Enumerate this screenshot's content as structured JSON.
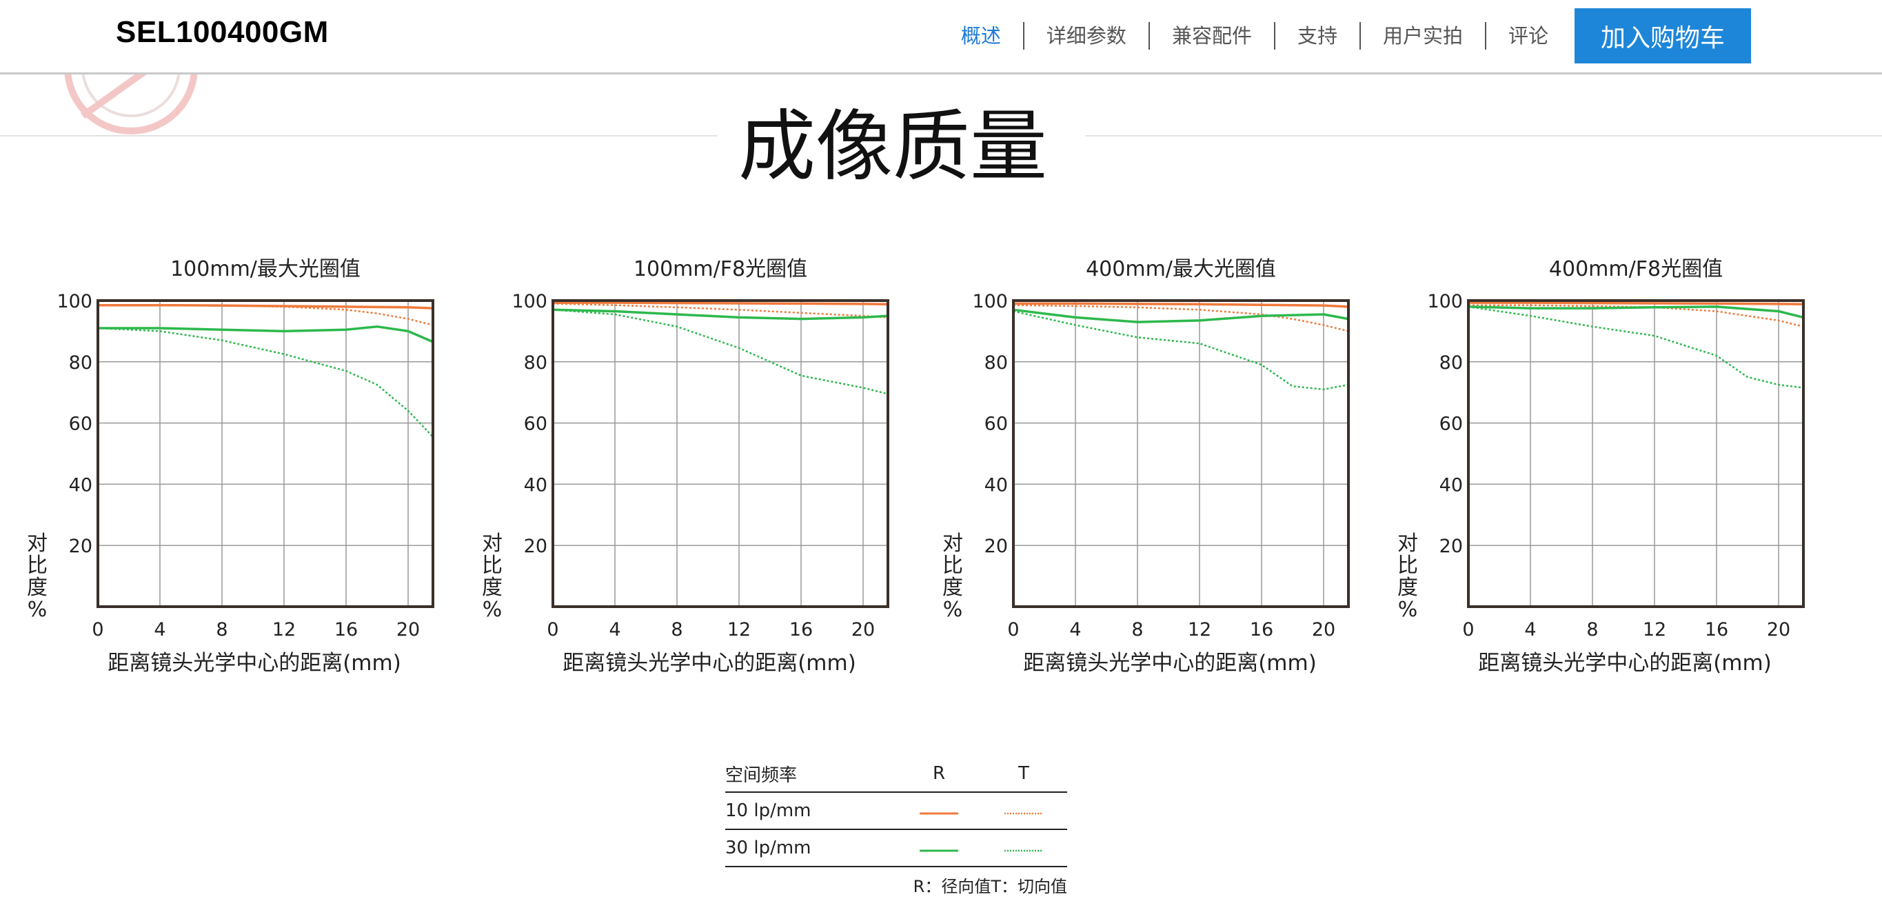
{
  "header": {
    "product_name": "SEL100400GM",
    "nav": [
      "概述",
      "详细参数",
      "兼容配件",
      "支持",
      "用户实拍",
      "评论"
    ],
    "active_nav": "概述",
    "cart_button": "加入购物车",
    "accent_color": "#1d86d9"
  },
  "section": {
    "title": "成像质量"
  },
  "colors": {
    "r10": "#f07a3c",
    "t10": "#f07a3c",
    "r30": "#2db84d",
    "t30": "#2db84d",
    "grid": "#999999",
    "frame": "#3a2f2a"
  },
  "chart_data": [
    {
      "type": "line",
      "title": "100mm/最大光圈值",
      "xlabel": "距离镜头光学中心的距离(mm)",
      "ylabel": "对比度%",
      "xlim": [
        0,
        21.6
      ],
      "ylim": [
        0,
        100
      ],
      "xticks": [
        0,
        4,
        8,
        12,
        16,
        20
      ],
      "yticks": [
        20,
        40,
        60,
        80,
        100
      ],
      "series": [
        {
          "name": "10 lp/mm R",
          "x": [
            0,
            4,
            8,
            12,
            16,
            20,
            21.6
          ],
          "y": [
            98.5,
            98.5,
            98.4,
            98.2,
            98.0,
            97.8,
            97.5
          ]
        },
        {
          "name": "10 lp/mm T",
          "x": [
            0,
            4,
            8,
            12,
            16,
            18,
            20,
            21.6
          ],
          "y": [
            98.5,
            98.5,
            98.3,
            98.0,
            97.0,
            95.8,
            94.0,
            92.0
          ]
        },
        {
          "name": "30 lp/mm R",
          "x": [
            0,
            4,
            8,
            12,
            16,
            18,
            20,
            21.6
          ],
          "y": [
            91.0,
            91.0,
            90.5,
            90.0,
            90.5,
            91.5,
            90.0,
            86.5
          ]
        },
        {
          "name": "30 lp/mm T",
          "x": [
            0,
            4,
            8,
            12,
            16,
            18,
            20,
            21.6
          ],
          "y": [
            91.0,
            90.0,
            87.0,
            82.5,
            77.0,
            72.5,
            64.0,
            55.5
          ]
        }
      ]
    },
    {
      "type": "line",
      "title": "100mm/F8光圈值",
      "xlabel": "距离镜头光学中心的距离(mm)",
      "ylabel": "对比度%",
      "xlim": [
        0,
        21.6
      ],
      "ylim": [
        0,
        100
      ],
      "xticks": [
        0,
        4,
        8,
        12,
        16,
        20
      ],
      "yticks": [
        20,
        40,
        60,
        80,
        100
      ],
      "series": [
        {
          "name": "10 lp/mm R",
          "x": [
            0,
            4,
            8,
            12,
            16,
            20,
            21.6
          ],
          "y": [
            99.3,
            99.3,
            99.2,
            99.1,
            99.0,
            98.9,
            98.8
          ]
        },
        {
          "name": "10 lp/mm T",
          "x": [
            0,
            4,
            8,
            12,
            16,
            20,
            21.6
          ],
          "y": [
            99.0,
            98.5,
            97.8,
            97.0,
            96.0,
            95.0,
            94.5
          ]
        },
        {
          "name": "30 lp/mm R",
          "x": [
            0,
            4,
            8,
            12,
            16,
            20,
            21.6
          ],
          "y": [
            97.0,
            96.5,
            95.5,
            94.5,
            94.0,
            94.5,
            95.0
          ]
        },
        {
          "name": "30 lp/mm T",
          "x": [
            0,
            4,
            8,
            12,
            16,
            20,
            21.6
          ],
          "y": [
            97.0,
            95.5,
            91.5,
            84.5,
            75.5,
            71.5,
            69.5
          ]
        }
      ]
    },
    {
      "type": "line",
      "title": "400mm/最大光圈值",
      "xlabel": "距离镜头光学中心的距离(mm)",
      "ylabel": "对比度%",
      "xlim": [
        0,
        21.6
      ],
      "ylim": [
        0,
        100
      ],
      "xticks": [
        0,
        4,
        8,
        12,
        16,
        20
      ],
      "yticks": [
        20,
        40,
        60,
        80,
        100
      ],
      "series": [
        {
          "name": "10 lp/mm R",
          "x": [
            0,
            4,
            8,
            12,
            16,
            20,
            21.6
          ],
          "y": [
            99.0,
            99.0,
            98.9,
            98.8,
            98.6,
            98.4,
            98.0
          ]
        },
        {
          "name": "10 lp/mm T",
          "x": [
            0,
            4,
            8,
            12,
            16,
            18,
            20,
            21.6
          ],
          "y": [
            98.5,
            98.2,
            97.8,
            97.0,
            95.5,
            94.0,
            92.0,
            90.0
          ]
        },
        {
          "name": "30 lp/mm R",
          "x": [
            0,
            4,
            8,
            12,
            16,
            20,
            21.6
          ],
          "y": [
            97.0,
            94.5,
            93.0,
            93.5,
            95.0,
            95.5,
            94.0
          ]
        },
        {
          "name": "30 lp/mm T",
          "x": [
            0,
            4,
            8,
            12,
            16,
            18,
            20,
            21.6
          ],
          "y": [
            96.5,
            92.0,
            88.0,
            86.0,
            79.0,
            72.0,
            71.0,
            72.5
          ]
        }
      ]
    },
    {
      "type": "line",
      "title": "400mm/F8光圈值",
      "xlabel": "距离镜头光学中心的距离(mm)",
      "ylabel": "对比度%",
      "xlim": [
        0,
        21.6
      ],
      "ylim": [
        0,
        100
      ],
      "xticks": [
        0,
        4,
        8,
        12,
        16,
        20
      ],
      "yticks": [
        20,
        40,
        60,
        80,
        100
      ],
      "series": [
        {
          "name": "10 lp/mm R",
          "x": [
            0,
            4,
            8,
            12,
            16,
            20,
            21.6
          ],
          "y": [
            99.3,
            99.3,
            99.2,
            99.1,
            99.0,
            98.9,
            98.8
          ]
        },
        {
          "name": "10 lp/mm T",
          "x": [
            0,
            4,
            8,
            12,
            16,
            18,
            20,
            21.6
          ],
          "y": [
            98.5,
            98.5,
            98.2,
            97.8,
            96.5,
            95.0,
            93.5,
            91.5
          ]
        },
        {
          "name": "30 lp/mm R",
          "x": [
            0,
            4,
            8,
            12,
            16,
            20,
            21.6
          ],
          "y": [
            98.0,
            97.5,
            97.5,
            97.8,
            98.0,
            96.5,
            94.5
          ]
        },
        {
          "name": "30 lp/mm T",
          "x": [
            0,
            4,
            8,
            12,
            16,
            18,
            20,
            21.6
          ],
          "y": [
            98.0,
            95.0,
            91.5,
            88.5,
            82.0,
            75.0,
            72.5,
            71.5
          ]
        }
      ]
    }
  ],
  "legend": {
    "header": [
      "空间频率",
      "R",
      "T"
    ],
    "rows": [
      {
        "label": "10 lp/mm",
        "r_color": "#f07a3c",
        "t_color": "#f07a3c"
      },
      {
        "label": "30 lp/mm",
        "r_color": "#2db84d",
        "t_color": "#2db84d"
      }
    ],
    "note": "R：径向值T：切向值"
  }
}
